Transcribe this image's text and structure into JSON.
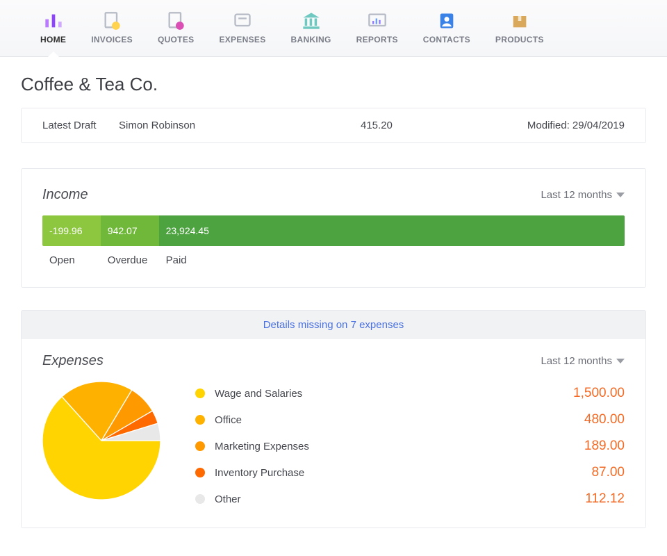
{
  "nav": [
    {
      "id": "home",
      "label": "HOME",
      "active": true
    },
    {
      "id": "invoices",
      "label": "INVOICES"
    },
    {
      "id": "quotes",
      "label": "QUOTES"
    },
    {
      "id": "expenses",
      "label": "EXPENSES"
    },
    {
      "id": "banking",
      "label": "BANKING"
    },
    {
      "id": "reports",
      "label": "REPORTS"
    },
    {
      "id": "contacts",
      "label": "CONTACTS"
    },
    {
      "id": "products",
      "label": "PRODUCTS"
    }
  ],
  "company": "Coffee & Tea Co.",
  "draft": {
    "label": "Latest Draft",
    "client": "Simon Robinson",
    "amount": "415.20",
    "modified_label": "Modified: 29/04/2019"
  },
  "income": {
    "title": "Income",
    "period": "Last 12 months",
    "segments": {
      "open": {
        "value": "-199.96",
        "label": "Open",
        "width": "10%"
      },
      "overdue": {
        "value": "942.07",
        "label": "Overdue",
        "width": "10%"
      },
      "paid": {
        "value": "23,924.45",
        "label": "Paid",
        "width": "80%"
      }
    }
  },
  "expenses": {
    "alert": "Details missing on 7 expenses",
    "title": "Expenses",
    "period": "Last 12 months",
    "items": [
      {
        "name": "Wage and Salaries",
        "value": "1,500.00",
        "color": "#ffd400"
      },
      {
        "name": "Office",
        "value": "480.00",
        "color": "#ffb100"
      },
      {
        "name": "Marketing Expenses",
        "value": "189.00",
        "color": "#ff9900"
      },
      {
        "name": "Inventory Purchase",
        "value": "87.00",
        "color": "#ff6a00"
      },
      {
        "name": "Other",
        "value": "112.12",
        "color": "#e8e8e8"
      }
    ]
  },
  "chart_data": {
    "type": "pie",
    "title": "Expenses",
    "series": [
      {
        "name": "Wage and Salaries",
        "value": 1500.0,
        "color": "#ffd400"
      },
      {
        "name": "Office",
        "value": 480.0,
        "color": "#ffb100"
      },
      {
        "name": "Marketing Expenses",
        "value": 189.0,
        "color": "#ff9900"
      },
      {
        "name": "Inventory Purchase",
        "value": 87.0,
        "color": "#ff6a00"
      },
      {
        "name": "Other",
        "value": 112.12,
        "color": "#e8e8e8"
      }
    ]
  }
}
